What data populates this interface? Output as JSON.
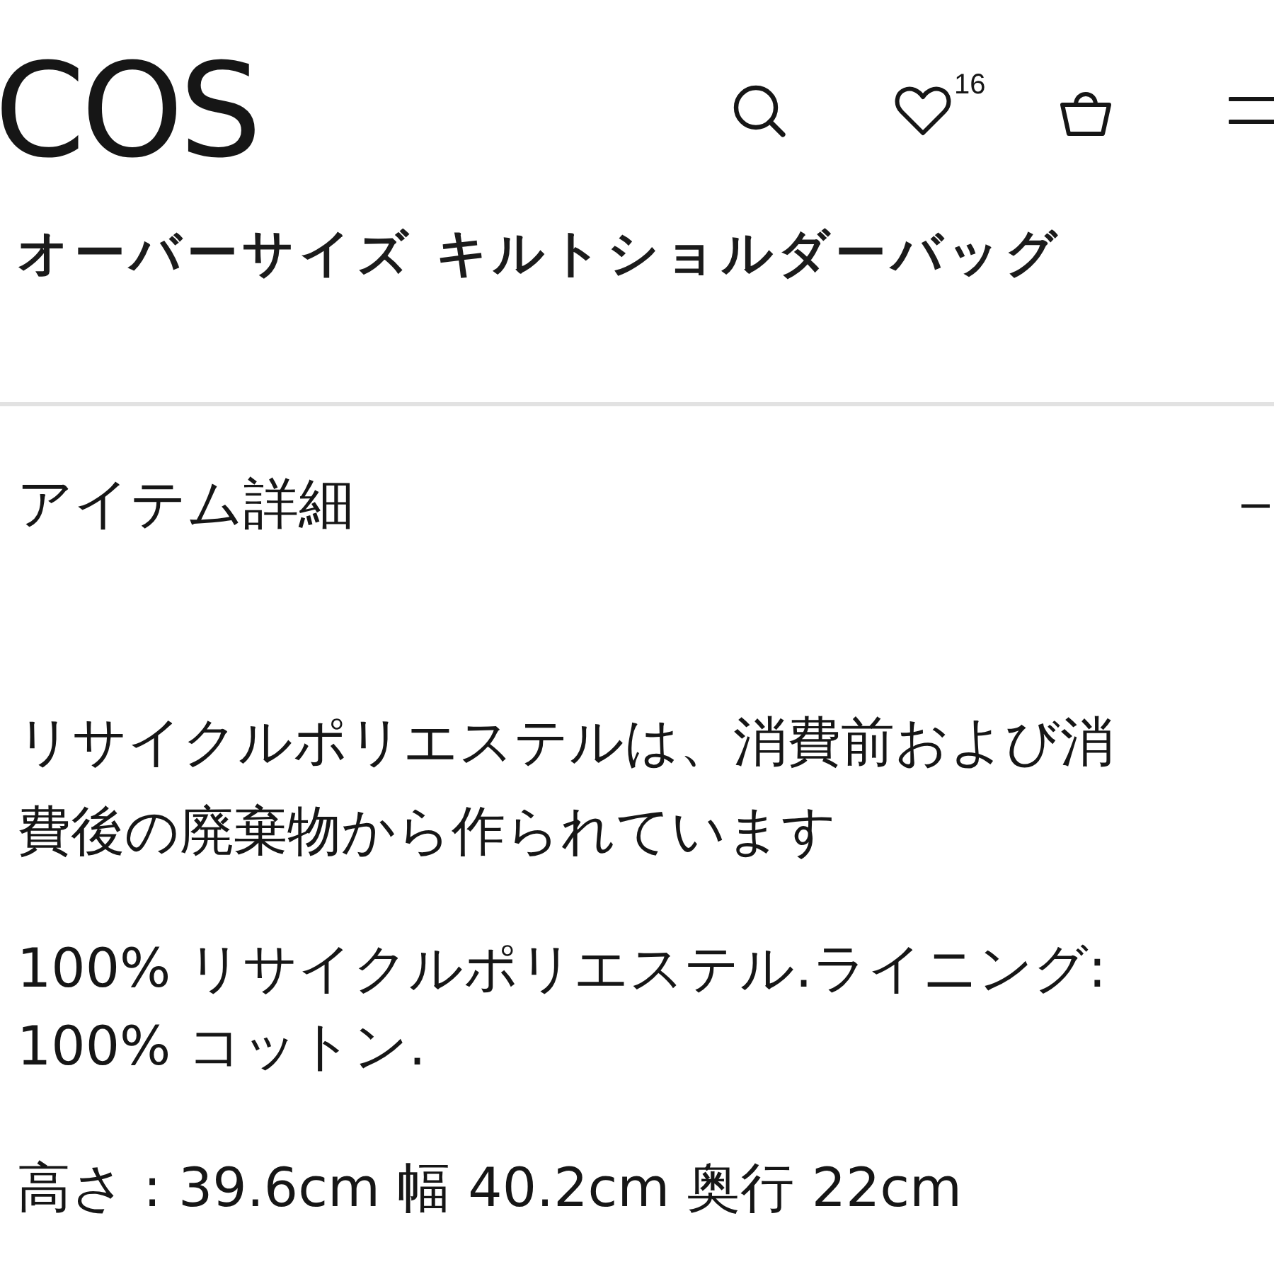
{
  "header": {
    "logo": "COS",
    "wishlist_count": "16"
  },
  "product": {
    "title": "オーバーサイズ キルトショルダーバッグ"
  },
  "accordion": {
    "title": "アイテム詳細",
    "expanded": true
  },
  "details": [
    "リサイクルポリエステルは、消費前および消費後の廃棄物から作られています",
    "100% リサイクルポリエステル.ライニング: 100% コットン.",
    "高さ : 39.6cm 幅 40.2cm 奥行 22cm"
  ]
}
